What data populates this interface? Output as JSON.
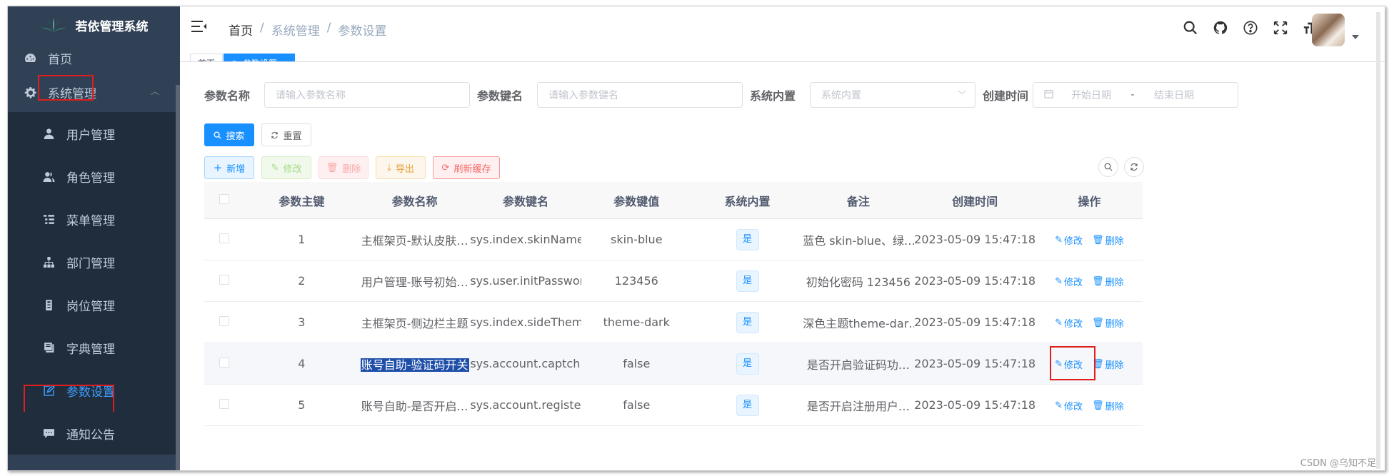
{
  "app": {
    "title": "若依管理系统"
  },
  "sidebar": {
    "items": [
      {
        "label": "首页",
        "icon": "dashboard-icon"
      },
      {
        "label": "系统管理",
        "icon": "gear-icon"
      },
      {
        "label": "用户管理",
        "icon": "user-icon"
      },
      {
        "label": "角色管理",
        "icon": "peoples-icon"
      },
      {
        "label": "菜单管理",
        "icon": "tree-table-icon"
      },
      {
        "label": "部门管理",
        "icon": "tree-icon"
      },
      {
        "label": "岗位管理",
        "icon": "post-icon"
      },
      {
        "label": "字典管理",
        "icon": "dict-icon"
      },
      {
        "label": "参数设置",
        "icon": "edit-icon",
        "active": true
      },
      {
        "label": "通知公告",
        "icon": "message-icon"
      }
    ]
  },
  "breadcrumb": {
    "home": "首页",
    "sep": "/",
    "level1": "系统管理",
    "level2": "参数设置"
  },
  "tags": {
    "home": "首页",
    "current": "参数设置 ×"
  },
  "search": {
    "config_name_label": "参数名称",
    "config_name_placeholder": "请输入参数名称",
    "config_key_label": "参数键名",
    "config_key_placeholder": "请输入参数键名",
    "config_type_label": "系统内置",
    "config_type_placeholder": "系统内置",
    "date_label": "创建时间",
    "start_placeholder": "开始日期",
    "date_sep": "-",
    "end_placeholder": "结束日期",
    "search_btn": "搜索",
    "reset_btn": "重置"
  },
  "toolbar": {
    "add": "新增",
    "edit": "修改",
    "delete": "删除",
    "export": "导出",
    "refresh_cache": "刷新缓存"
  },
  "table": {
    "headers": [
      "参数主键",
      "参数名称",
      "参数键名",
      "参数键值",
      "系统内置",
      "备注",
      "创建时间",
      "操作"
    ],
    "rows": [
      {
        "id": "1",
        "name": "主框架页-默认皮肤…",
        "key": "sys.index.skinName",
        "value": "skin-blue",
        "builtin": "是",
        "remark": "蓝色 skin-blue、绿…",
        "time": "2023-05-09 15:47:18"
      },
      {
        "id": "2",
        "name": "用户管理-账号初始…",
        "key": "sys.user.initPassword",
        "value": "123456",
        "builtin": "是",
        "remark": "初始化密码 123456",
        "time": "2023-05-09 15:47:18"
      },
      {
        "id": "3",
        "name": "主框架页-侧边栏主题",
        "key": "sys.index.sideTheme",
        "value": "theme-dark",
        "builtin": "是",
        "remark": "深色主题theme-dar…",
        "time": "2023-05-09 15:47:18"
      },
      {
        "id": "4",
        "name": "账号自助-验证码开关",
        "key": "sys.account.captch…",
        "value": "false",
        "builtin": "是",
        "remark": "是否开启验证码功…",
        "time": "2023-05-09 15:47:18"
      },
      {
        "id": "5",
        "name": "账号自助-是否开启…",
        "key": "sys.account.registe…",
        "value": "false",
        "builtin": "是",
        "remark": "是否开启注册用户…",
        "time": "2023-05-09 15:47:18"
      }
    ],
    "op_edit": "修改",
    "op_delete": "删除"
  },
  "watermark": "CSDN @乌知不足",
  "colors": {
    "sidebar_bg": "#304156",
    "primary": "#1890ff",
    "highlight_box": "#e01e1e"
  }
}
